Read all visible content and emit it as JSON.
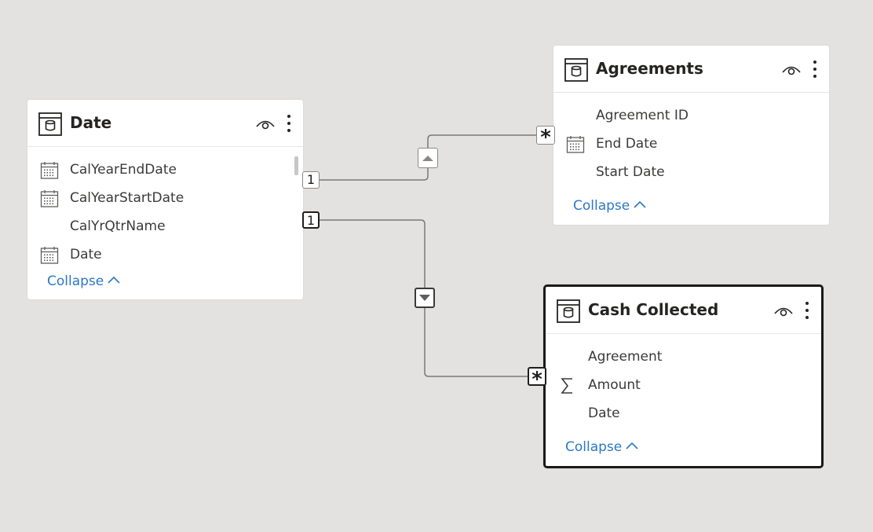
{
  "tables": {
    "date": {
      "title": "Date",
      "fields": [
        {
          "name": "CalYearEndDate",
          "icon": "calendar-icon"
        },
        {
          "name": "CalYearStartDate",
          "icon": "calendar-icon"
        },
        {
          "name": "CalYrQtrName",
          "icon": ""
        },
        {
          "name": "Date",
          "icon": "calendar-icon"
        }
      ],
      "collapse_label": "Collapse"
    },
    "agreements": {
      "title": "Agreements",
      "fields": [
        {
          "name": "Agreement ID",
          "icon": ""
        },
        {
          "name": "End Date",
          "icon": "calendar-icon"
        },
        {
          "name": "Start Date",
          "icon": ""
        }
      ],
      "collapse_label": "Collapse"
    },
    "cash_collected": {
      "title": "Cash Collected",
      "fields": [
        {
          "name": "Agreement",
          "icon": ""
        },
        {
          "name": "Amount",
          "icon": "sigma-icon"
        },
        {
          "name": "Date",
          "icon": "calendar-icon"
        }
      ],
      "collapse_label": "Collapse",
      "selected": true
    }
  },
  "relationships": [
    {
      "from": "Date",
      "to": "Agreements",
      "from_cardinality": "1",
      "to_cardinality": "*",
      "direction": "up-arrow-icon"
    },
    {
      "from": "Date",
      "to": "Cash Collected",
      "from_cardinality": "1",
      "to_cardinality": "*",
      "direction": "down-arrow-icon"
    }
  ],
  "colors": {
    "canvas": "#e3e2e0",
    "card": "#ffffff",
    "link": "#2b78c5",
    "connector": "#8a8886",
    "selected_border": "#1a1a1a"
  }
}
